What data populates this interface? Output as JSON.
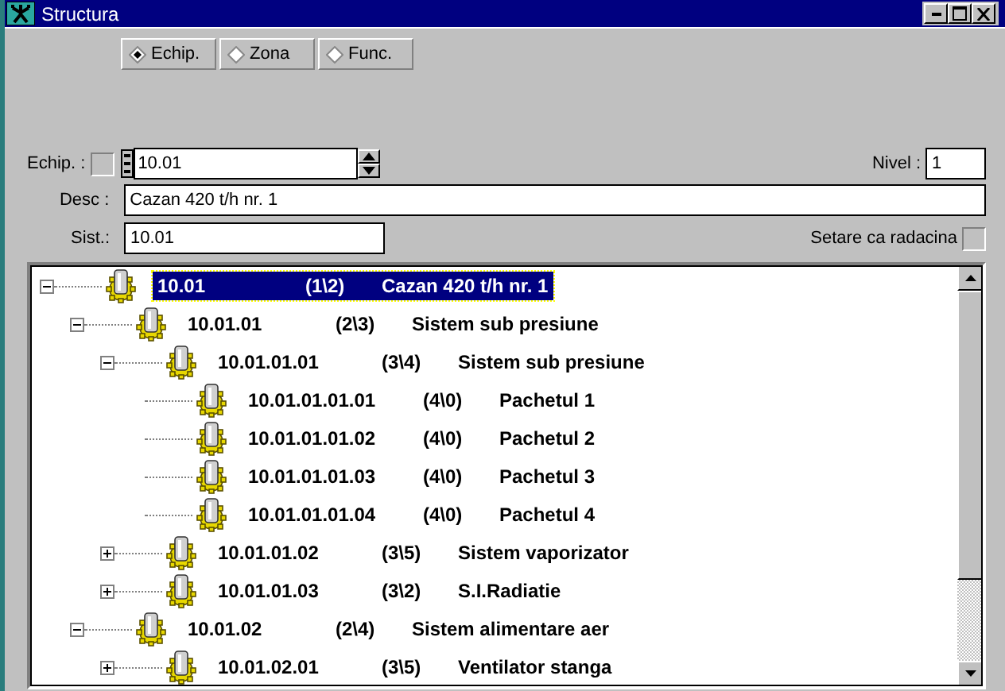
{
  "window": {
    "title": "Structura"
  },
  "modes": [
    {
      "label": "Echip.",
      "selected": true
    },
    {
      "label": "Zona",
      "selected": false
    },
    {
      "label": "Func.",
      "selected": false
    }
  ],
  "form": {
    "echip_label": "Echip. :",
    "echip_checked": false,
    "echip_value": "10.01",
    "nivel_label": "Nivel :",
    "nivel_value": "1",
    "desc_label": "Desc :",
    "desc_value": "Cazan 420 t/h nr. 1",
    "sist_label": "Sist.:",
    "sist_value": "10.01",
    "root_label": "Setare ca radacina",
    "root_checked": false
  },
  "tree": [
    {
      "code": "10.01",
      "count": "(1\\2)",
      "name": "Cazan 420 t/h nr. 1",
      "selected": true,
      "expanded": true,
      "children": [
        {
          "code": "10.01.01",
          "count": "(2\\3)",
          "name": "Sistem sub presiune",
          "selected": false,
          "expanded": true,
          "children": [
            {
              "code": "10.01.01.01",
              "count": "(3\\4)",
              "name": "Sistem sub presiune",
              "selected": false,
              "expanded": true,
              "children": [
                {
                  "code": "10.01.01.01.01",
                  "count": "(4\\0)",
                  "name": "Pachetul 1",
                  "selected": false
                },
                {
                  "code": "10.01.01.01.02",
                  "count": "(4\\0)",
                  "name": "Pachetul 2",
                  "selected": false
                },
                {
                  "code": "10.01.01.01.03",
                  "count": "(4\\0)",
                  "name": "Pachetul 3",
                  "selected": false
                },
                {
                  "code": "10.01.01.01.04",
                  "count": "(4\\0)",
                  "name": "Pachetul 4",
                  "selected": false
                }
              ]
            },
            {
              "code": "10.01.01.02",
              "count": "(3\\5)",
              "name": "Sistem vaporizator",
              "selected": false,
              "expanded": false
            },
            {
              "code": "10.01.01.03",
              "count": "(3\\2)",
              "name": "S.I.Radiatie",
              "selected": false,
              "expanded": false
            }
          ]
        },
        {
          "code": "10.01.02",
          "count": "(2\\4)",
          "name": "Sistem alimentare aer",
          "selected": false,
          "expanded": true,
          "children": [
            {
              "code": "10.01.02.01",
              "count": "(3\\5)",
              "name": "Ventilator stanga",
              "selected": false,
              "expanded": false
            }
          ]
        }
      ]
    }
  ]
}
